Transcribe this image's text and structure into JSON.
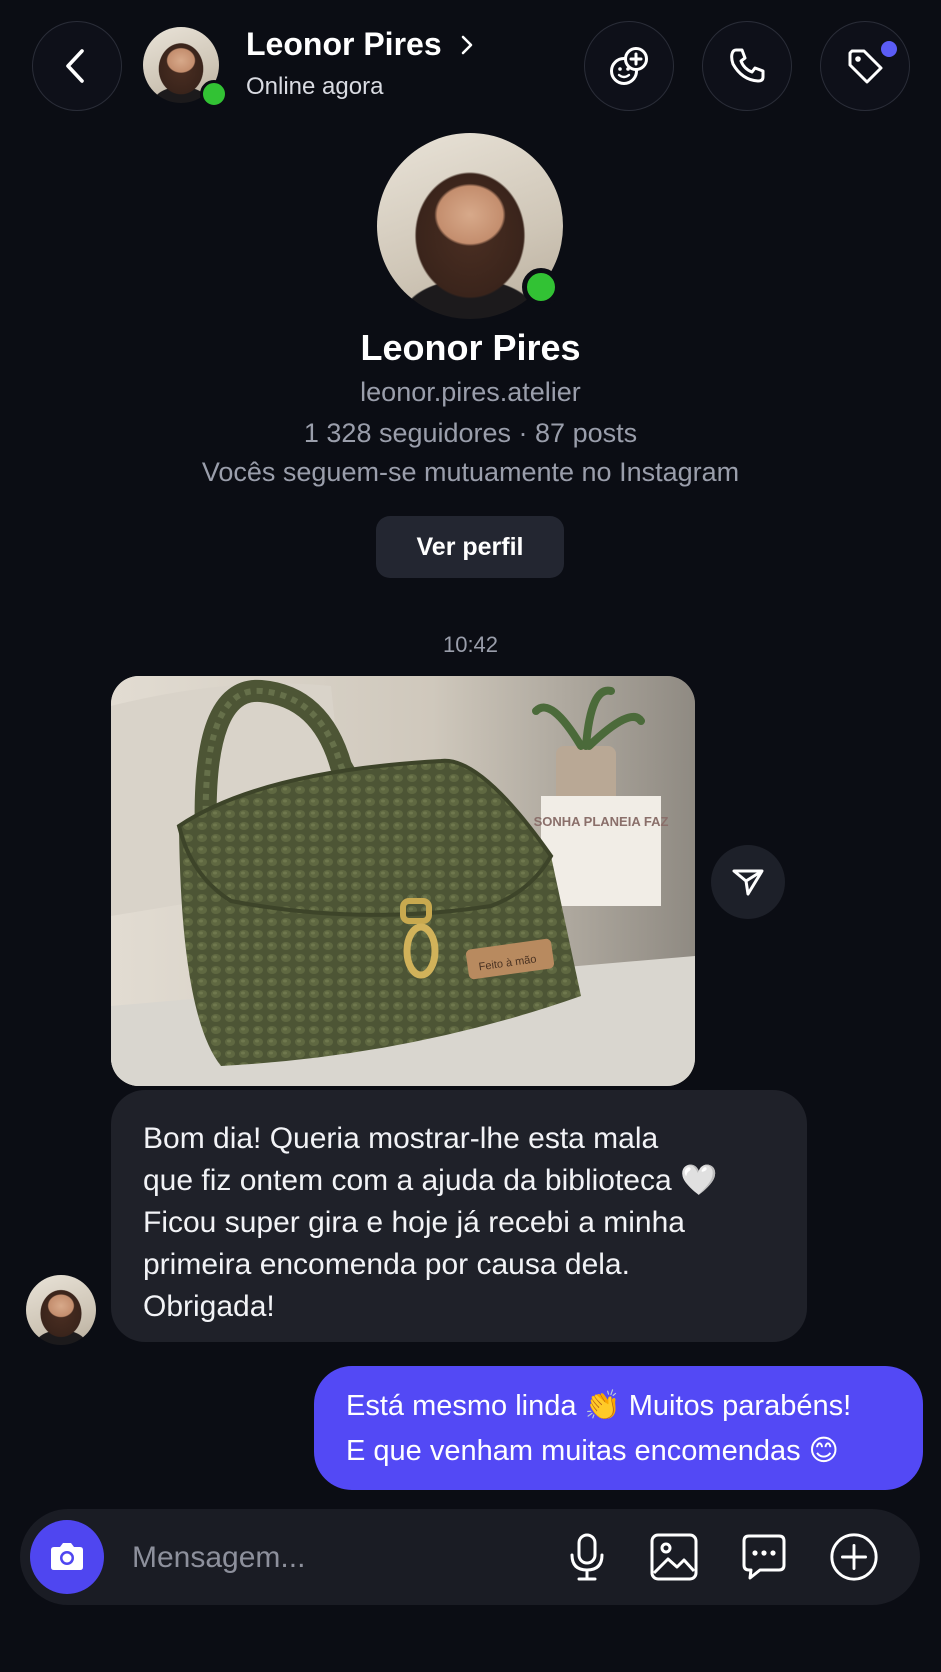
{
  "header": {
    "contact_name": "Leonor Pires",
    "status": "Online agora"
  },
  "profile": {
    "name": "Leonor Pires",
    "username": "leonor.pires.atelier",
    "stats": "1 328 seguidores · 87 posts",
    "mutual": "Vocês seguem-se mutuamente no Instagram",
    "view_profile_label": "Ver perfil"
  },
  "conversation": {
    "timestamp": "10:42",
    "photo_tag_text": "Feito à mão",
    "photo_sign_text": "SONHA PLANEIA FAZ",
    "incoming_lines": [
      "Bom dia! Queria mostrar-lhe esta mala",
      "que fiz ontem com a ajuda da biblioteca 🤍",
      "Ficou super gira e hoje já recebi a minha",
      "primeira encomenda por causa dela.",
      "Obrigada!"
    ],
    "outgoing_lines": [
      "Está mesmo linda 👏 Muitos parabéns!",
      "E que venham muitas encomendas 😊"
    ]
  },
  "composer": {
    "placeholder": "Mensagem..."
  },
  "colors": {
    "background": "#0b0d14",
    "accent": "#5349f5",
    "online": "#32c234",
    "notification": "#5b5cf6"
  },
  "icons": [
    "back-icon",
    "chevron-right-icon",
    "sticker-add-icon",
    "phone-icon",
    "tag-icon",
    "send-icon",
    "camera-icon",
    "microphone-icon",
    "image-icon",
    "chat-bubble-icon",
    "plus-circle-icon"
  ]
}
